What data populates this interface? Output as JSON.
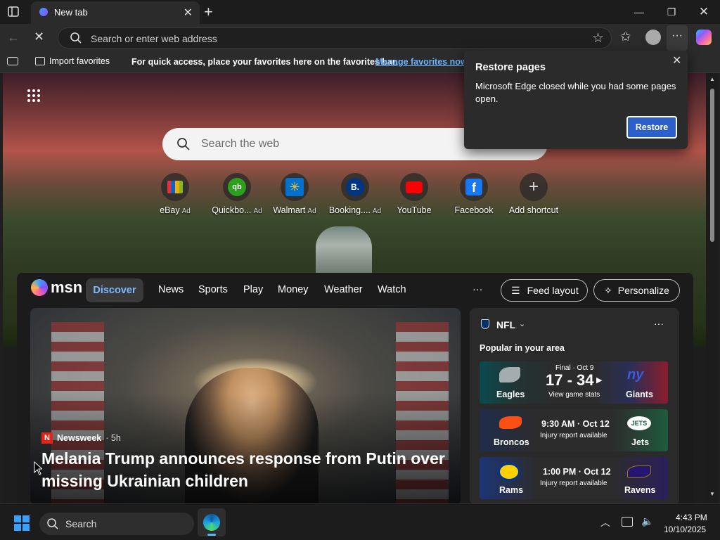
{
  "browser": {
    "tab_title": "New tab",
    "address_placeholder": "Search or enter web address"
  },
  "favorites_bar": {
    "import_label": "Import favorites",
    "hint": "For quick access, place your favorites here on the favorites bar.",
    "manage_link": "Manage favorites now"
  },
  "restore_popup": {
    "title": "Restore pages",
    "message": "Microsoft Edge closed while you had some pages open.",
    "button": "Restore"
  },
  "newtab": {
    "search_placeholder": "Search the web",
    "shortcuts": [
      {
        "label": "eBay",
        "ad": "Ad",
        "icon": "ebay-icon"
      },
      {
        "label": "Quickbo...",
        "ad": "Ad",
        "icon": "quickbooks-icon"
      },
      {
        "label": "Walmart",
        "ad": "Ad",
        "icon": "walmart-icon"
      },
      {
        "label": "Booking....",
        "ad": "Ad",
        "icon": "booking-icon"
      },
      {
        "label": "YouTube",
        "ad": "",
        "icon": "youtube-icon"
      },
      {
        "label": "Facebook",
        "ad": "",
        "icon": "facebook-icon"
      },
      {
        "label": "Add shortcut",
        "ad": "",
        "icon": "plus-icon"
      }
    ]
  },
  "msn": {
    "logo": "msn",
    "nav": [
      "Discover",
      "News",
      "Sports",
      "Play",
      "Money",
      "Weather",
      "Watch"
    ],
    "more": "···",
    "feed_layout": "Feed layout",
    "personalize": "Personalize",
    "hero": {
      "source": "Newsweek",
      "time": "· 5h",
      "headline": "Melania Trump announces response from Putin over missing Ukrainian children"
    },
    "nfl": {
      "title": "NFL",
      "subtitle": "Popular in your area",
      "games": [
        {
          "home": "Eagles",
          "away": "Giants",
          "status": "Final · Oct 9",
          "score": "17 - 34",
          "sub": "View game stats",
          "home_color": "#0b4a4e",
          "away_color": "#1e2a6b"
        },
        {
          "home": "Broncos",
          "away": "Jets",
          "status": "",
          "score": "9:30 AM · Oct 12",
          "sub": "Injury report available",
          "home_color": "#1f2c4a",
          "away_color": "#1f5a3c"
        },
        {
          "home": "Rams",
          "away": "Ravens",
          "status": "",
          "score": "1:00 PM · Oct 12",
          "sub": "Injury report available",
          "home_color": "#1d3476",
          "away_color": "#2b1f5a"
        }
      ]
    }
  },
  "taskbar": {
    "search_label": "Search",
    "time": "4:43 PM",
    "date": "10/10/2025"
  }
}
